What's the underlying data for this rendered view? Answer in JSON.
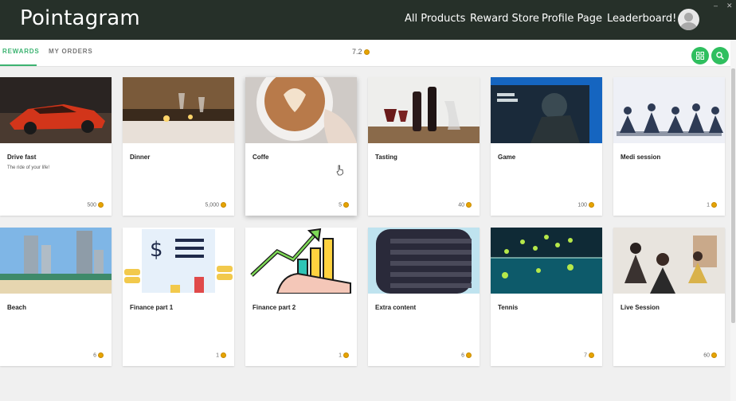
{
  "app": {
    "title": "Pointagram"
  },
  "nav": {
    "all_products": "All Products",
    "reward_store": "Reward Store",
    "profile_page": "Profile Page",
    "leaderboard": "Leaderboard!"
  },
  "window_controls": {
    "minimize": "–",
    "close": "✕"
  },
  "tabs": {
    "rewards": "REWARDS",
    "my_orders": "MY ORDERS"
  },
  "points": {
    "balance": "7.2"
  },
  "icons": {
    "grid": "grid-icon",
    "search": "search-icon",
    "coin": "coin-icon",
    "avatar": "user-avatar-icon"
  },
  "colors": {
    "header": "#263029",
    "accent": "#3cb371",
    "button": "#2fbf5f",
    "coin": "#e6a400"
  },
  "rewards": [
    {
      "title": "Drive fast",
      "subtitle": "The ride of your life!",
      "price": "500"
    },
    {
      "title": "Dinner",
      "subtitle": "",
      "price": "5,000"
    },
    {
      "title": "Coffe",
      "subtitle": "",
      "price": "5"
    },
    {
      "title": "Tasting",
      "subtitle": "",
      "price": "40"
    },
    {
      "title": "Game",
      "subtitle": "",
      "price": "100"
    },
    {
      "title": "Medi session",
      "subtitle": "",
      "price": "1"
    },
    {
      "title": "Beach",
      "subtitle": "",
      "price": "6"
    },
    {
      "title": "Finance part 1",
      "subtitle": "",
      "price": "1"
    },
    {
      "title": "Finance part 2",
      "subtitle": "",
      "price": "1"
    },
    {
      "title": "Extra content",
      "subtitle": "",
      "price": "6"
    },
    {
      "title": "Tennis",
      "subtitle": "",
      "price": "7"
    },
    {
      "title": "Live Session",
      "subtitle": "",
      "price": "60"
    }
  ]
}
